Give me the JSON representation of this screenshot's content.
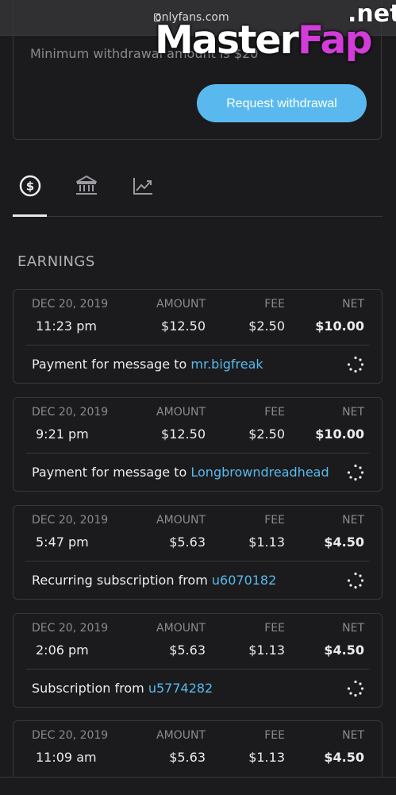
{
  "browser": {
    "url": "onlyfans.com"
  },
  "watermark": {
    "main": "Master",
    "accent": "Fap",
    "suffix": ".net"
  },
  "withdrawal": {
    "min_text": "Minimum withdrawal amount is $20",
    "button_label": "Request withdrawal",
    "button_color": "#59b9ee"
  },
  "tabs": [
    {
      "icon": "dollar-icon",
      "active": true
    },
    {
      "icon": "bank-icon",
      "active": false
    },
    {
      "icon": "chart-icon",
      "active": false
    }
  ],
  "section_title": "EARNINGS",
  "columns": {
    "amount": "AMOUNT",
    "fee": "FEE",
    "net": "NET"
  },
  "earnings": [
    {
      "date": "DEC 20, 2019",
      "time": "11:23 pm",
      "amount": "$12.50",
      "fee": "$2.50",
      "net": "$10.00",
      "desc_prefix": "Payment for message to",
      "desc_link": "mr.bigfreak"
    },
    {
      "date": "DEC 20, 2019",
      "time": "9:21 pm",
      "amount": "$12.50",
      "fee": "$2.50",
      "net": "$10.00",
      "desc_prefix": "Payment for message to",
      "desc_link": "Longbrowndreadhead"
    },
    {
      "date": "DEC 20, 2019",
      "time": "5:47 pm",
      "amount": "$5.63",
      "fee": "$1.13",
      "net": "$4.50",
      "desc_prefix": "Recurring subscription from",
      "desc_link": "u6070182"
    },
    {
      "date": "DEC 20, 2019",
      "time": "2:06 pm",
      "amount": "$5.63",
      "fee": "$1.13",
      "net": "$4.50",
      "desc_prefix": "Subscription from",
      "desc_link": "u5774282"
    },
    {
      "date": "DEC 20, 2019",
      "time": "11:09 am",
      "amount": "$5.63",
      "fee": "$1.13",
      "net": "$4.50"
    }
  ]
}
